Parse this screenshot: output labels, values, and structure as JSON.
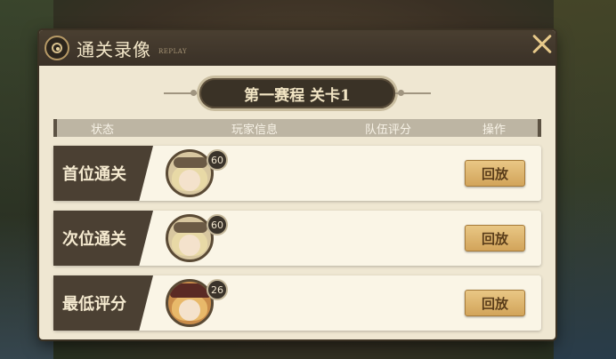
{
  "header": {
    "title": "通关录像",
    "subtitle": "REPLAY"
  },
  "stage": {
    "label": "第一赛程 关卡1"
  },
  "columns": {
    "status": "状态",
    "player": "玩家信息",
    "team_score": "队伍评分",
    "action": "操作"
  },
  "rows": [
    {
      "label": "首位通关",
      "level": "60",
      "avatar": "blonde-boy-goggles",
      "button": "回放"
    },
    {
      "label": "次位通关",
      "level": "60",
      "avatar": "blonde-boy-goggles",
      "button": "回放"
    },
    {
      "label": "最低评分",
      "level": "26",
      "avatar": "blonde-girl-hat",
      "button": "回放"
    }
  ],
  "colors": {
    "panel": "#efe7d2",
    "header": "#3a3127",
    "label_bg": "#4b4033",
    "button": "#d2a45a",
    "close": "#e7c98a"
  }
}
